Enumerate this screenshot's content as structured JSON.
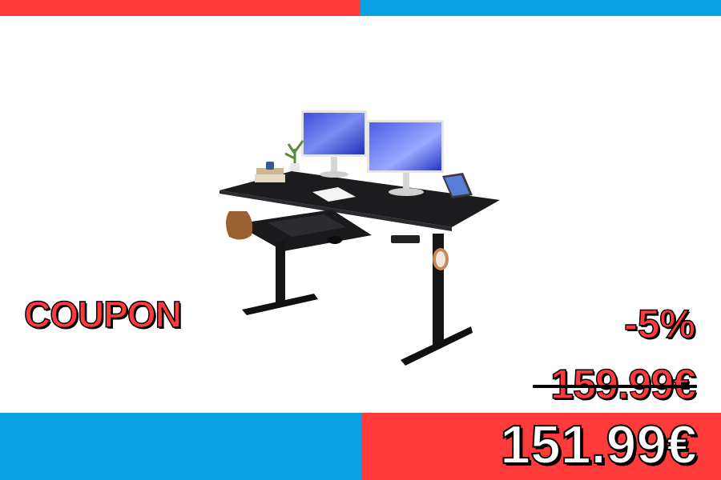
{
  "colors": {
    "accent_red": "#ff3a3a",
    "accent_blue": "#0a9fe0",
    "background": "#ffffff",
    "price_new_text": "#ffffff"
  },
  "banner": {
    "coupon_label": "COUPON",
    "discount_label": "-5%",
    "old_price": "159.99€",
    "new_price": "151.99€"
  },
  "product": {
    "image": "standing-desk-photo"
  }
}
